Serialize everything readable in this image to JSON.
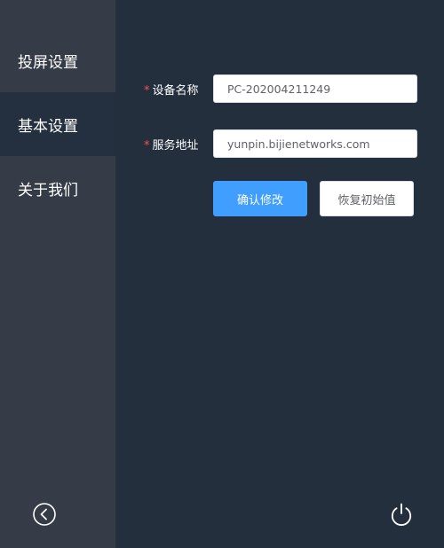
{
  "sidebar": {
    "items": [
      {
        "label": "投屏设置"
      },
      {
        "label": "基本设置"
      },
      {
        "label": "关于我们"
      }
    ],
    "back_icon": "chevron-left-circle-icon"
  },
  "form": {
    "device_name": {
      "required_mark": "*",
      "label": "设备名称",
      "value": "PC-202004211249"
    },
    "service_address": {
      "required_mark": "*",
      "label": "服务地址",
      "value": "yunpin.bijienetworks.com"
    },
    "confirm_label": "确认修改",
    "reset_label": "恢复初始值"
  },
  "power_icon": "power-icon",
  "colors": {
    "sidebar_bg": "#353c47",
    "main_bg": "#242f3e",
    "active_item_bg": "#24303f",
    "primary": "#409eff",
    "required": "#ff4d4f"
  }
}
